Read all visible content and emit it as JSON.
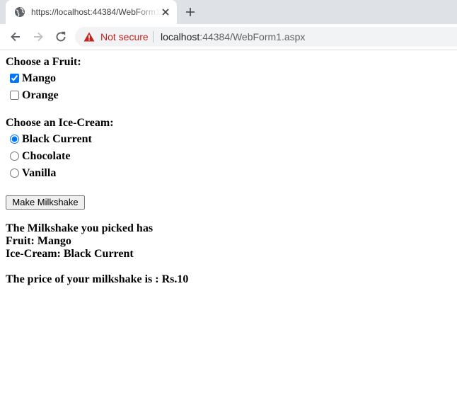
{
  "browser": {
    "tab_title": "https://localhost:44384/WebForm1.aspx",
    "security_label": "Not secure",
    "url_host": "localhost",
    "url_rest": ":44384/WebForm1.aspx"
  },
  "form": {
    "fruit_heading": "Choose a Fruit:",
    "fruits": [
      {
        "label": "Mango",
        "checked": true
      },
      {
        "label": "Orange",
        "checked": false
      }
    ],
    "icecream_heading": "Choose an Ice-Cream:",
    "icecreams": [
      {
        "label": "Black Current",
        "selected": true
      },
      {
        "label": "Chocolate",
        "selected": false
      },
      {
        "label": "Vanilla",
        "selected": false
      }
    ],
    "button_label": "Make Milkshake"
  },
  "result": {
    "summary_heading": "The Milkshake you picked has",
    "fruit_line": "Fruit: Mango",
    "icecream_line": "Ice-Cream: Black Current",
    "price_line": "The price of your milkshake is : Rs.10"
  },
  "colors": {
    "tabstrip": "#dee1e6",
    "omnibox": "#f1f3f4",
    "warning_red": "#c5221f",
    "radio_blue": "#1a73e8"
  },
  "icons": [
    "globe-icon",
    "close-icon",
    "plus-icon",
    "back-arrow-icon",
    "forward-arrow-icon",
    "reload-icon",
    "warning-triangle-icon"
  ]
}
